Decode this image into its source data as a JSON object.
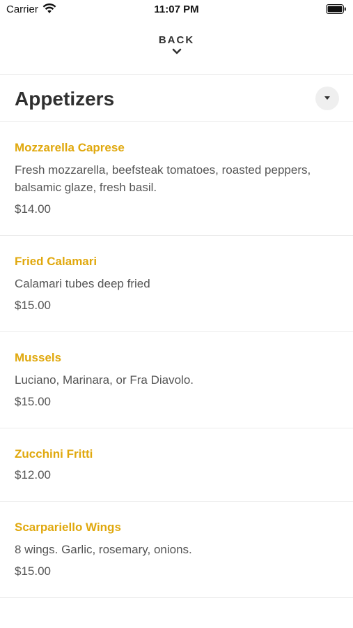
{
  "status_bar": {
    "carrier": "Carrier",
    "time": "11:07 PM",
    "wifi_icon": "wifi-icon",
    "battery_icon": "battery-icon"
  },
  "nav": {
    "back_label": "BACK",
    "back_icon": "chevron-down-icon"
  },
  "section": {
    "title": "Appetizers",
    "toggle_icon": "caret-down-icon"
  },
  "colors": {
    "accent": "#e0a80d",
    "text": "#555555",
    "title": "#2f2f2f"
  },
  "menu_items": [
    {
      "name": "Mozzarella Caprese",
      "description": "Fresh mozzarella, beefsteak tomatoes, roasted peppers, balsamic glaze, fresh basil.",
      "price": "$14.00"
    },
    {
      "name": "Fried Calamari",
      "description": "Calamari tubes deep fried",
      "price": "$15.00"
    },
    {
      "name": "Mussels",
      "description": "Luciano, Marinara, or Fra Diavolo.",
      "price": "$15.00"
    },
    {
      "name": "Zucchini Fritti",
      "description": "",
      "price": "$12.00"
    },
    {
      "name": "Scarpariello Wings",
      "description": "8 wings. Garlic, rosemary, onions.",
      "price": "$15.00"
    }
  ]
}
